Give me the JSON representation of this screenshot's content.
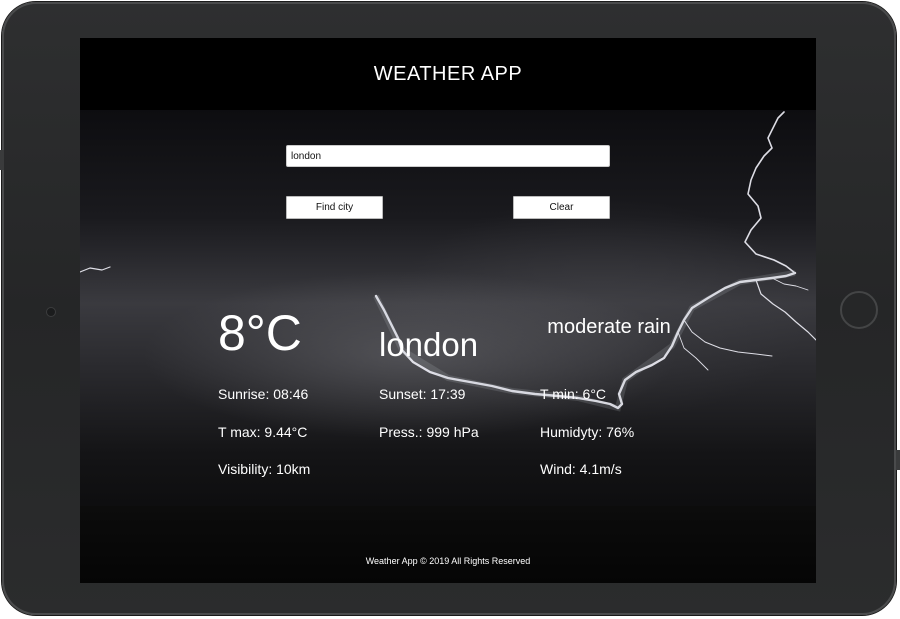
{
  "header": {
    "title": "WEATHER APP"
  },
  "search": {
    "value": "london",
    "find_label": "Find city",
    "clear_label": "Clear"
  },
  "current": {
    "temperature": "8°C",
    "city": "london",
    "description": "moderate rain"
  },
  "details": {
    "sunrise": "Sunrise: 08:46",
    "sunset": "Sunset: 17:39",
    "temp_min": "T min: 6°C",
    "temp_max": "T max: 9.44°C",
    "pressure": "Press.: 999 hPa",
    "humidity": "Humidyty: 76%",
    "visibility": "Visibility: 10km",
    "wind": "Wind: 4.1m/s"
  },
  "footer": {
    "text": "Weather App © 2019 All Rights Reserved"
  }
}
